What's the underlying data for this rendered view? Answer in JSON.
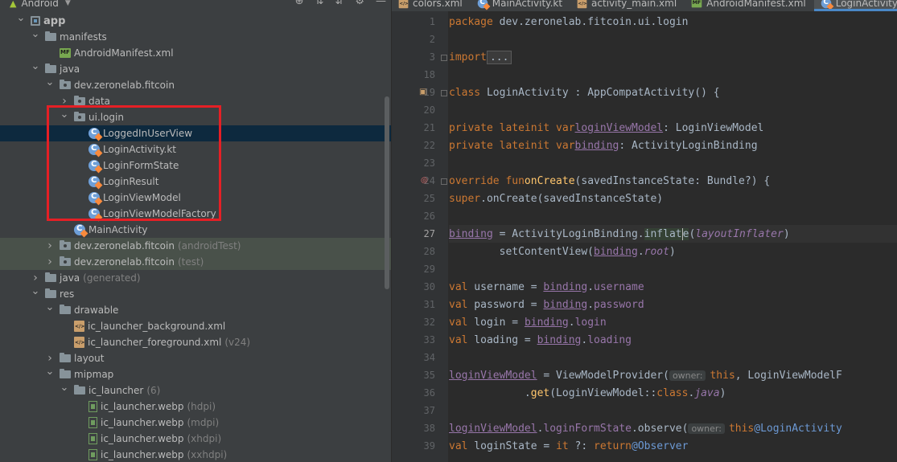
{
  "project": {
    "view_label": "Android",
    "tree": [
      {
        "label": "app",
        "indent": 0,
        "arrow": "open",
        "icon": "appmod",
        "bold": true
      },
      {
        "label": "manifests",
        "indent": 1,
        "arrow": "open",
        "icon": "folder"
      },
      {
        "label": "AndroidManifest.xml",
        "indent": 2,
        "arrow": "none",
        "icon": "mf"
      },
      {
        "label": "java",
        "indent": 1,
        "arrow": "open",
        "icon": "folder"
      },
      {
        "label": "dev.zeronelab.fitcoin",
        "indent": 2,
        "arrow": "open",
        "icon": "pkg"
      },
      {
        "label": "data",
        "indent": 3,
        "arrow": "closed",
        "icon": "pkg"
      },
      {
        "label": "ui.login",
        "indent": 3,
        "arrow": "open",
        "icon": "pkg"
      },
      {
        "label": "LoggedInUserView",
        "indent": 4,
        "arrow": "none",
        "icon": "kt",
        "selected": true
      },
      {
        "label": "LoginActivity.kt",
        "indent": 4,
        "arrow": "none",
        "icon": "kt"
      },
      {
        "label": "LoginFormState",
        "indent": 4,
        "arrow": "none",
        "icon": "kt"
      },
      {
        "label": "LoginResult",
        "indent": 4,
        "arrow": "none",
        "icon": "kt"
      },
      {
        "label": "LoginViewModel",
        "indent": 4,
        "arrow": "none",
        "icon": "kt"
      },
      {
        "label": "LoginViewModelFactory",
        "indent": 4,
        "arrow": "none",
        "icon": "kt"
      },
      {
        "label": "MainActivity",
        "indent": 3,
        "arrow": "none",
        "icon": "kt"
      },
      {
        "label": "dev.zeronelab.fitcoin",
        "suffix": "(androidTest)",
        "indent": 2,
        "arrow": "closed",
        "icon": "pkg",
        "test": true
      },
      {
        "label": "dev.zeronelab.fitcoin",
        "suffix": "(test)",
        "indent": 2,
        "arrow": "closed",
        "icon": "pkg",
        "test": true
      },
      {
        "label": "java",
        "suffix": "(generated)",
        "indent": 1,
        "arrow": "closed",
        "icon": "folder"
      },
      {
        "label": "res",
        "indent": 1,
        "arrow": "open",
        "icon": "folder"
      },
      {
        "label": "drawable",
        "indent": 2,
        "arrow": "open",
        "icon": "folder"
      },
      {
        "label": "ic_launcher_background.xml",
        "indent": 3,
        "arrow": "none",
        "icon": "xml"
      },
      {
        "label": "ic_launcher_foreground.xml",
        "suffix": "(v24)",
        "indent": 3,
        "arrow": "none",
        "icon": "xml"
      },
      {
        "label": "layout",
        "indent": 2,
        "arrow": "closed",
        "icon": "folder"
      },
      {
        "label": "mipmap",
        "indent": 2,
        "arrow": "open",
        "icon": "folder"
      },
      {
        "label": "ic_launcher",
        "suffix": "(6)",
        "indent": 3,
        "arrow": "open",
        "icon": "folder"
      },
      {
        "label": "ic_launcher.webp",
        "suffix": "(hdpi)",
        "indent": 4,
        "arrow": "none",
        "icon": "img"
      },
      {
        "label": "ic_launcher.webp",
        "suffix": "(mdpi)",
        "indent": 4,
        "arrow": "none",
        "icon": "img"
      },
      {
        "label": "ic_launcher.webp",
        "suffix": "(xhdpi)",
        "indent": 4,
        "arrow": "none",
        "icon": "img"
      },
      {
        "label": "ic_launcher.webp",
        "suffix": "(xxhdpi)",
        "indent": 4,
        "arrow": "none",
        "icon": "img"
      }
    ]
  },
  "editor": {
    "tabs": [
      {
        "label": "colors.xml",
        "icon": "xml"
      },
      {
        "label": "MainActivity.kt",
        "icon": "kt"
      },
      {
        "label": "activity_main.xml",
        "icon": "xml"
      },
      {
        "label": "AndroidManifest.xml",
        "icon": "mf"
      },
      {
        "label": "LoginActivity.kt",
        "icon": "kt",
        "active": true
      }
    ],
    "lines": [
      {
        "n": "1",
        "html": "<span class='kw'>package</span> dev.zeronelab.fitcoin.ui.login"
      },
      {
        "n": "2",
        "html": ""
      },
      {
        "n": "3",
        "html": "<span class='kw'>import</span> <span class='fold-box'>...</span>"
      },
      {
        "n": "18",
        "html": ""
      },
      {
        "n": "19",
        "html": "<span class='kw'>class</span> LoginActivity : AppCompatActivity() {"
      },
      {
        "n": "20",
        "html": ""
      },
      {
        "n": "21",
        "html": "    <span class='kw'>private lateinit var</span> <span class='prop ul'>loginViewModel</span>: LoginViewModel"
      },
      {
        "n": "22",
        "html": "    <span class='kw'>private lateinit var</span> <span class='prop ul'>binding</span>: ActivityLoginBinding"
      },
      {
        "n": "23",
        "html": ""
      },
      {
        "n": "24",
        "html": "    <span class='kw'>override fun</span> <span class='fn'>onCreate</span>(savedInstanceState: Bundle?) {"
      },
      {
        "n": "25",
        "html": "        <span class='kw'>super</span>.onCreate(savedInstanceState)"
      },
      {
        "n": "26",
        "html": ""
      },
      {
        "n": "27",
        "html": "        <span class='prop ul'>binding</span> = ActivityLoginBinding.<span style='background:#344134'>inflat</span><span class='caretline'></span><span style='background:#344134'>e</span>(<span class='prop it'>layoutInflater</span>)",
        "cur": true
      },
      {
        "n": "28",
        "html": "        setContentView(<span class='prop ul'>binding</span>.<span class='prop it'>root</span>)"
      },
      {
        "n": "29",
        "html": ""
      },
      {
        "n": "30",
        "html": "        <span class='kw'>val</span> username = <span class='prop ul'>binding</span>.<span class='prop'>username</span>"
      },
      {
        "n": "31",
        "html": "        <span class='kw'>val</span> password = <span class='prop ul'>binding</span>.<span class='prop'>password</span>"
      },
      {
        "n": "32",
        "html": "        <span class='kw'>val</span> login = <span class='prop ul'>binding</span>.<span class='prop'>login</span>"
      },
      {
        "n": "33",
        "html": "        <span class='kw'>val</span> loading = <span class='prop ul'>binding</span>.<span class='prop'>loading</span>"
      },
      {
        "n": "34",
        "html": ""
      },
      {
        "n": "35",
        "html": "        <span class='prop ul'>loginViewModel</span> = ViewModelProvider(<span class='hint'>owner:</span><span class='kw'>this</span>, LoginViewModelF"
      },
      {
        "n": "36",
        "html": "            .<span class='fn'>get</span>(LoginViewModel::<span class='kw'>class</span>.<span class='prop it'>java</span>)"
      },
      {
        "n": "37",
        "html": ""
      },
      {
        "n": "38",
        "html": "        <span class='prop ul'>loginViewModel</span>.<span class='prop'>loginFormState</span>.observe(<span class='hint'>owner:</span><span class='kw'>this</span><span class='lbl'>@LoginActivity</span>"
      },
      {
        "n": "39",
        "html": "            <span class='kw'>val</span> loginState = <span class='kw'>it</span> ?: <span class='kw'>return</span><span class='lbl'>@Observer</span>"
      }
    ]
  }
}
